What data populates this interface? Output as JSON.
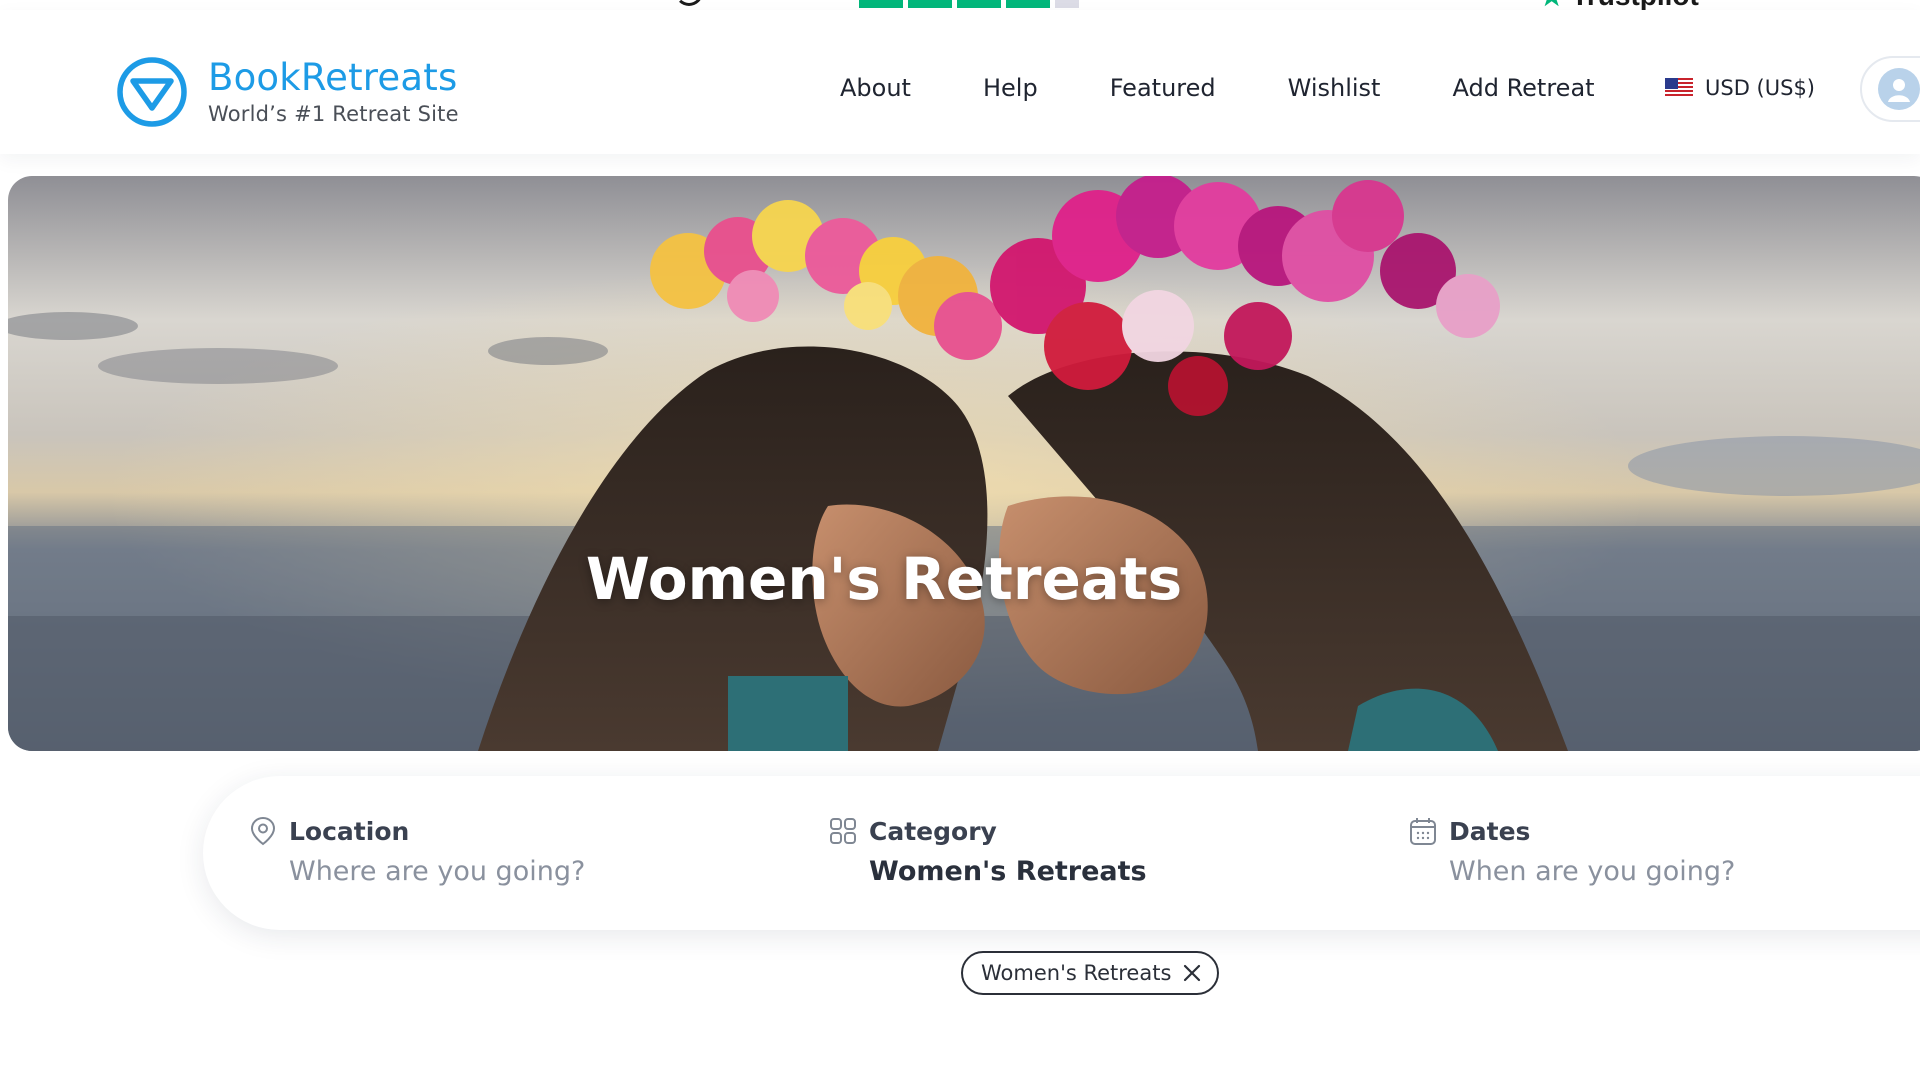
{
  "trustpilot": {
    "label": "Trustpilot"
  },
  "header": {
    "brand": "BookRetreats",
    "tagline": "World’s #1 Retreat Site",
    "nav": [
      {
        "label": "About"
      },
      {
        "label": "Help"
      },
      {
        "label": "Featured"
      },
      {
        "label": "Wishlist"
      },
      {
        "label": "Add Retreat"
      }
    ],
    "currency": "USD (US$)",
    "brand_color": "#1d9be6"
  },
  "hero": {
    "title": "Women's Retreats"
  },
  "search": {
    "location": {
      "label": "Location",
      "placeholder": "Where are you going?",
      "icon": "map-pin-icon"
    },
    "category": {
      "label": "Category",
      "value": "Women's Retreats",
      "icon": "grid-icon"
    },
    "dates": {
      "label": "Dates",
      "placeholder": "When are you going?",
      "icon": "calendar-icon"
    }
  },
  "filters": [
    {
      "label": "Women's Retreats"
    }
  ]
}
